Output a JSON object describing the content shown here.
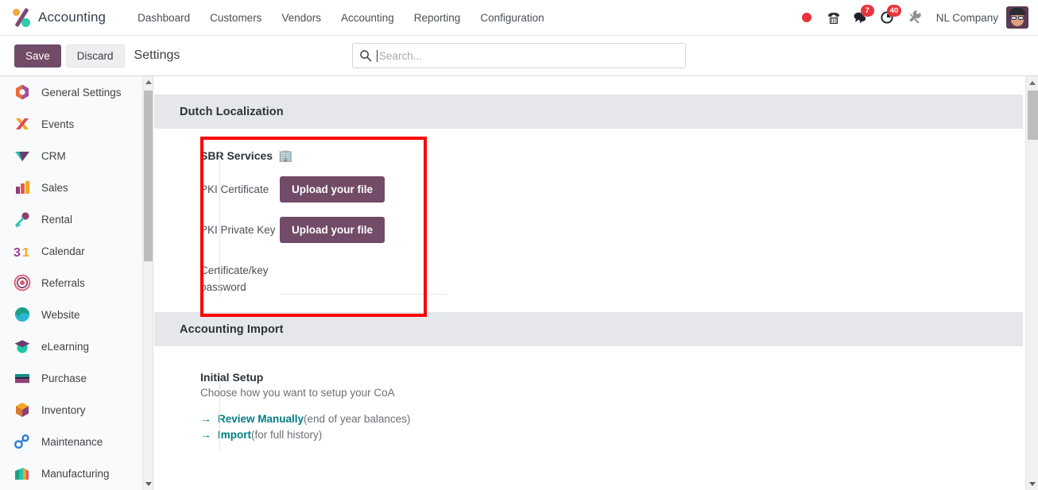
{
  "navbar": {
    "brand": "Accounting",
    "brand_logo_icon": "odoo-accounting-logo",
    "menu": [
      {
        "label": "Dashboard"
      },
      {
        "label": "Customers"
      },
      {
        "label": "Vendors"
      },
      {
        "label": "Accounting"
      },
      {
        "label": "Reporting"
      },
      {
        "label": "Configuration"
      }
    ],
    "systray": {
      "record_icon": "record-dot-icon",
      "phone_icon": "phone-dialpad-icon",
      "messages_icon": "chat-bubble-icon",
      "messages_count": "7",
      "activities_icon": "clock-activity-icon",
      "activities_count": "40",
      "tools_icon": "wrench-tools-icon",
      "company": "NL Company",
      "avatar_icon": "user-avatar"
    }
  },
  "control_panel": {
    "save_label": "Save",
    "discard_label": "Discard",
    "breadcrumb": "Settings"
  },
  "search": {
    "placeholder": "Search...",
    "value": "",
    "icon": "search-icon"
  },
  "sidebar": {
    "items": [
      {
        "label": "General Settings",
        "icon": "settings-app-icon"
      },
      {
        "label": "Events",
        "icon": "events-app-icon"
      },
      {
        "label": "CRM",
        "icon": "crm-app-icon"
      },
      {
        "label": "Sales",
        "icon": "sales-app-icon"
      },
      {
        "label": "Rental",
        "icon": "rental-key-icon"
      },
      {
        "label": "Calendar",
        "icon": "calendar-31-icon"
      },
      {
        "label": "Referrals",
        "icon": "referrals-app-icon"
      },
      {
        "label": "Website",
        "icon": "website-app-icon"
      },
      {
        "label": "eLearning",
        "icon": "elearning-graduation-icon"
      },
      {
        "label": "Purchase",
        "icon": "purchase-app-icon"
      },
      {
        "label": "Inventory",
        "icon": "inventory-box-icon"
      },
      {
        "label": "Maintenance",
        "icon": "maintenance-app-icon"
      },
      {
        "label": "Manufacturing",
        "icon": "manufacturing-app-icon"
      }
    ],
    "scroll_up_icon": "scroll-up-arrow",
    "scroll_down_icon": "scroll-down-arrow"
  },
  "main": {
    "sections": [
      {
        "title": "Dutch Localization",
        "block": {
          "title": "SBR Services",
          "title_icon": "building-icon",
          "title_icon_glyph": "🏢",
          "fields": [
            {
              "label": "PKI Certificate",
              "control": "button",
              "button_label": "Upload your file"
            },
            {
              "label": "PKI Private Key",
              "control": "button",
              "button_label": "Upload your file"
            },
            {
              "label": "Certificate/key password",
              "control": "password",
              "value": "",
              "placeholder": ""
            }
          ]
        }
      },
      {
        "title": "Accounting Import",
        "block": {
          "title": "Initial Setup",
          "subtitle": "Choose how you want to setup your CoA",
          "links": [
            {
              "arrow": "→",
              "label": "Review Manually",
              "note": "(end of year balances)"
            },
            {
              "arrow": "→",
              "label": "Import",
              "note": "(for full history)"
            }
          ]
        }
      }
    ]
  },
  "scrollbar": {
    "up_icon": "scroll-up-arrow",
    "down_icon": "scroll-down-arrow"
  },
  "annotation": {
    "highlight_color": "#fb0007",
    "target": "sbr-services-block"
  },
  "colors": {
    "primary": "#714b67",
    "link": "#017e84",
    "section_header_bg": "#e5e7eb",
    "badge": "#e8343c"
  }
}
